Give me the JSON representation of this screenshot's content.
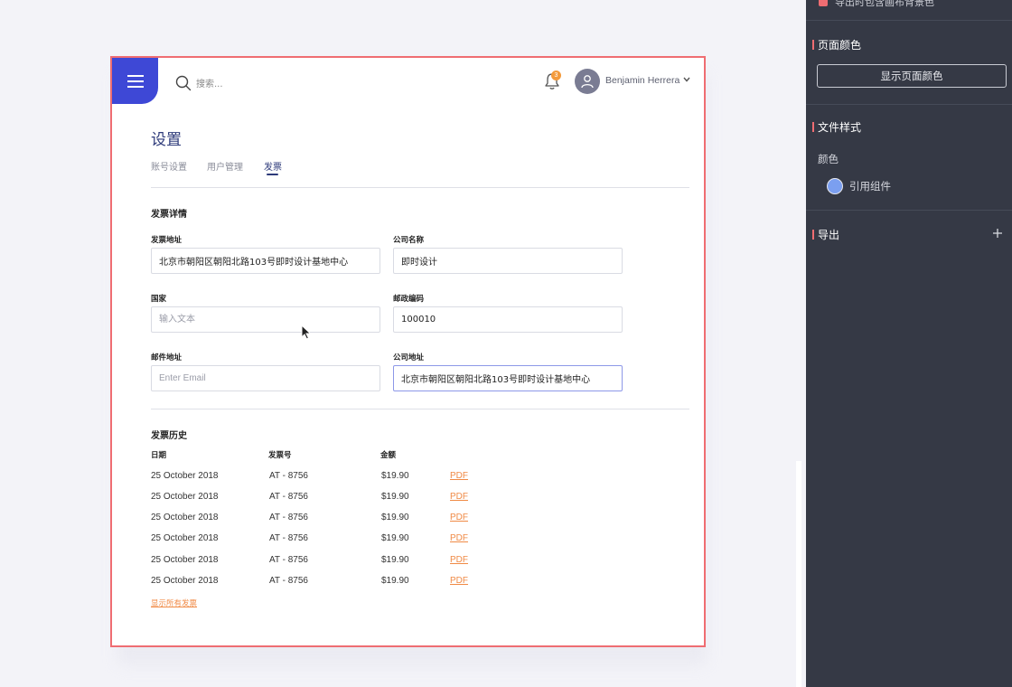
{
  "header": {
    "search_placeholder": "搜索...",
    "notification_count": "3",
    "user_name": "Benjamin Herrera"
  },
  "settings": {
    "title": "设置",
    "tabs": [
      {
        "label": "账号设置",
        "active": false
      },
      {
        "label": "用户管理",
        "active": false
      },
      {
        "label": "发票",
        "active": true
      }
    ]
  },
  "invoice_details": {
    "title": "发票详情",
    "fields": {
      "invoice_address": {
        "label": "发票地址",
        "value": "北京市朝阳区朝阳北路103号即时设计基地中心",
        "placeholder": ""
      },
      "company_name": {
        "label": "公司名称",
        "value": "即时设计",
        "placeholder": ""
      },
      "country": {
        "label": "国家",
        "value": "",
        "placeholder": "输入文本"
      },
      "postal_code": {
        "label": "邮政编码",
        "value": "100010",
        "placeholder": ""
      },
      "mail_address": {
        "label": "邮件地址",
        "value": "",
        "placeholder": "Enter Email"
      },
      "company_address": {
        "label": "公司地址",
        "value": "北京市朝阳区朝阳北路103号即时设计基地中心",
        "placeholder": ""
      }
    }
  },
  "invoice_history": {
    "title": "发票历史",
    "columns": [
      "日期",
      "发票号",
      "金额"
    ],
    "rows": [
      {
        "date": "25 October 2018",
        "number": "AT - 8756",
        "amount": "$19.90",
        "link": "PDF"
      },
      {
        "date": "25 October 2018",
        "number": "AT - 8756",
        "amount": "$19.90",
        "link": "PDF"
      },
      {
        "date": "25 October 2018",
        "number": "AT - 8756",
        "amount": "$19.90",
        "link": "PDF"
      },
      {
        "date": "25 October 2018",
        "number": "AT - 8756",
        "amount": "$19.90",
        "link": "PDF"
      },
      {
        "date": "25 October 2018",
        "number": "AT - 8756",
        "amount": "$19.90",
        "link": "PDF"
      },
      {
        "date": "25 October 2018",
        "number": "AT - 8756",
        "amount": "$19.90",
        "link": "PDF"
      }
    ],
    "show_all": "显示所有发票"
  },
  "side_panel": {
    "top_item": "导出时包含画布背景色",
    "page_color": {
      "heading": "页面颜色",
      "button": "显示页面颜色"
    },
    "file_style": {
      "heading": "文件样式",
      "color_label": "颜色",
      "color_item": "引用组件",
      "color_item_hex": "#7b9ff0"
    },
    "export": {
      "heading": "导出"
    }
  },
  "colors": {
    "accent": "#3e48d6",
    "selection_border": "#ef6d72",
    "link": "#f08a45",
    "panel_bg": "#353945"
  }
}
